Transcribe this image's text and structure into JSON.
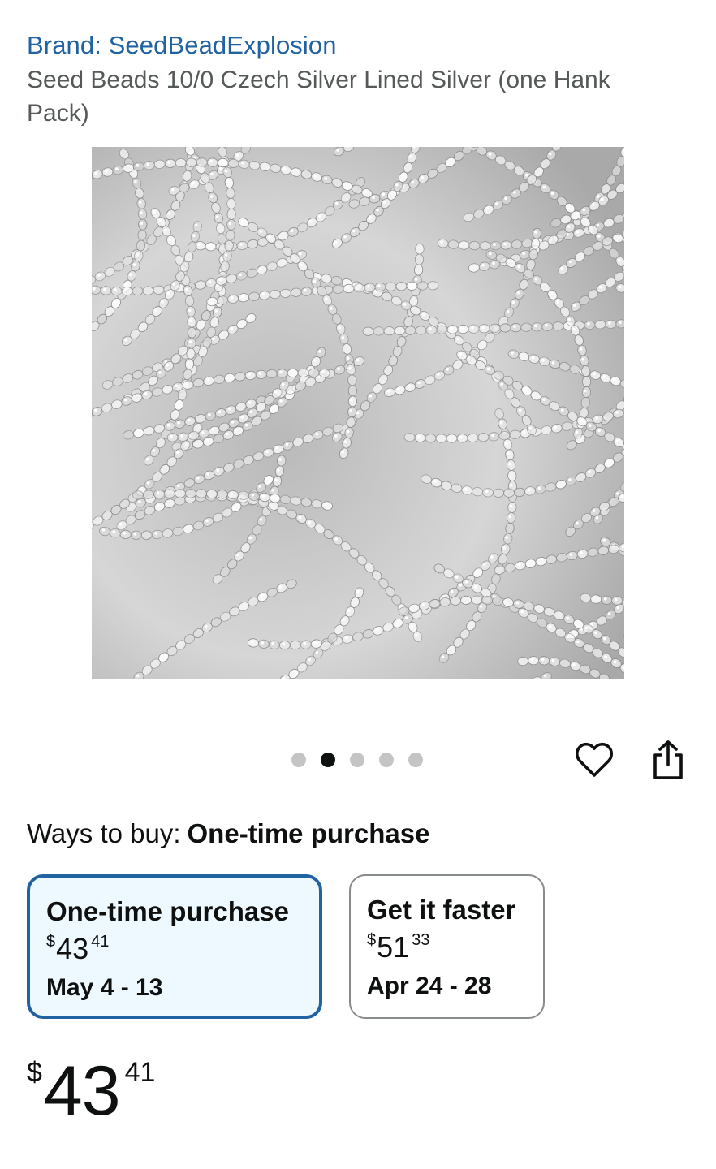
{
  "product": {
    "brand_label": "Brand: SeedBeadExplosion",
    "title": "Seed Beads 10/0 Czech Silver Lined Silver (one Hank Pack)"
  },
  "gallery": {
    "image_name": "silver-lined-seed-beads-photo",
    "total_images": 5,
    "current_index": 2
  },
  "actions": {
    "heart_icon": "heart-icon",
    "share_icon": "share-icon"
  },
  "ways_to_buy": {
    "label": "Ways to buy:",
    "selected": "One-time purchase",
    "options": [
      {
        "title": "One-time purchase",
        "currency": "$",
        "whole": "43",
        "fraction": "41",
        "dates": "May 4 - 13"
      },
      {
        "title": "Get it faster",
        "currency": "$",
        "whole": "51",
        "fraction": "33",
        "dates": "Apr 24 - 28"
      }
    ]
  },
  "price": {
    "currency": "$",
    "whole": "43",
    "fraction": "41"
  },
  "colors": {
    "link_blue": "#2162a1",
    "selected_card_bg": "#edf9ff",
    "text": "#0f1111",
    "muted": "#565959"
  }
}
